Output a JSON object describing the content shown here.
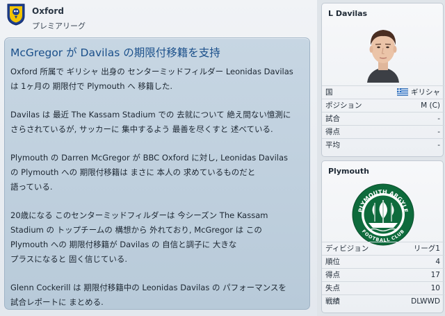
{
  "header": {
    "club_name": "Oxford",
    "league_name": "プレミアリーグ"
  },
  "article": {
    "headline": "McGregor が Davilas の期限付移籍を支持",
    "paragraphs": [
      [
        "Oxford 所属で ギリシャ 出身の センターミッドフィルダー Leonidas Davilas",
        "は 1ヶ月の 期限付で Plymouth へ 移籍した."
      ],
      [
        "Davilas は 最近 The Kassam Stadium での 去就について 絶え間ない憶測に",
        "さらされているが, サッカーに 集中するよう 最善を尽くすと 述べている."
      ],
      [
        "Plymouth の Darren McGregor が BBC Oxford に対し, Leonidas Davilas",
        "の Plymouth への 期限付移籍は まさに 本人の 求めているものだと",
        "語っている."
      ],
      [
        "20歳になる このセンターミッドフィルダーは 今シーズン The Kassam",
        "Stadium の トップチームの 構想から 外れており, McGregor は この",
        "Plymouth への 期限付移籍が Davilas の 自信と調子に 大きな",
        "プラスになると 固く信じている."
      ],
      [
        "Glenn Cockerill は 期限付移籍中の Leonidas Davilas の パフォーマンスを",
        "試合レポートに まとめる."
      ]
    ]
  },
  "player_card": {
    "name": "L Davilas",
    "rows": [
      {
        "label": "国",
        "value": "ギリシャ"
      },
      {
        "label": "ポジション",
        "value": "M (C)"
      },
      {
        "label": "試合",
        "value": "-"
      },
      {
        "label": "得点",
        "value": "-"
      },
      {
        "label": "平均",
        "value": "-"
      }
    ]
  },
  "club_card": {
    "name": "Plymouth",
    "crest_text_top": "PLYMOUTH ARGYLE",
    "crest_text_bottom": "FOOTBALL CLUB",
    "rows": [
      {
        "label": "ディビジョン",
        "value": "リーグ1"
      },
      {
        "label": "順位",
        "value": "4"
      },
      {
        "label": "得点",
        "value": "17"
      },
      {
        "label": "失点",
        "value": "10"
      },
      {
        "label": "戦績",
        "value": "DLWWD"
      }
    ]
  },
  "colors": {
    "headline": "#1a4f8a",
    "article_bg": "#c2d3e1",
    "crest_green": "#0e6b3c"
  },
  "icons": {
    "club_badge": "oxford-club-badge",
    "flag": "greece-flag-icon",
    "crest": "plymouth-argyle-crest"
  }
}
